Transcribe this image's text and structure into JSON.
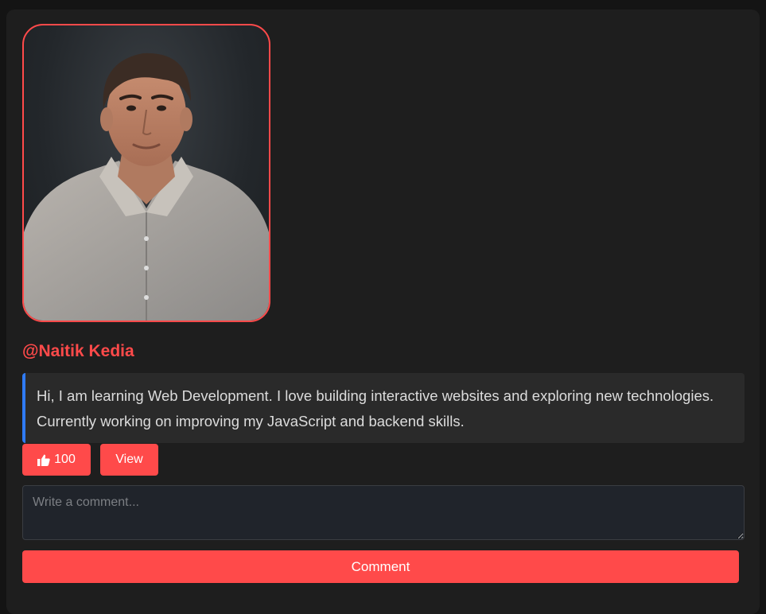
{
  "profile": {
    "username": "@Naitik Kedia",
    "bio": "Hi, I am learning Web Development. I love building interactive websites and exploring new technologies. Currently working on improving my JavaScript and backend skills."
  },
  "actions": {
    "like_count": "100",
    "like_icon": "thumbs-up-icon",
    "view_label": "View"
  },
  "comment": {
    "placeholder": "Write a comment...",
    "value": "",
    "submit_label": "Comment"
  },
  "colors": {
    "accent": "#ff4a4a",
    "quote_border": "#2f7bf5",
    "card_bg": "#1e1e1e",
    "page_bg": "#141414"
  }
}
